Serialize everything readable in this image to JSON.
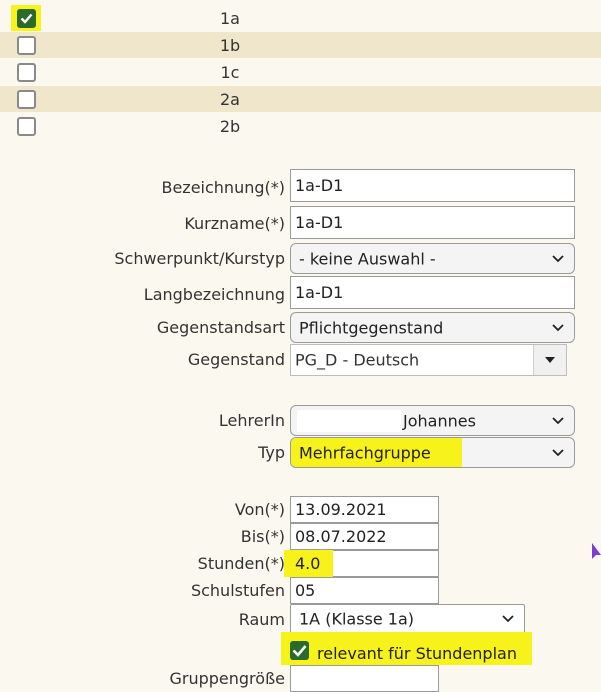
{
  "classes": [
    {
      "label": "1a",
      "checked": true
    },
    {
      "label": "1b",
      "checked": false
    },
    {
      "label": "1c",
      "checked": false
    },
    {
      "label": "2a",
      "checked": false
    },
    {
      "label": "2b",
      "checked": false
    }
  ],
  "form": {
    "bezeichnung": {
      "label": "Bezeichnung(*)",
      "value": "1a-D1"
    },
    "kurzname": {
      "label": "Kurzname(*)",
      "value": "1a-D1"
    },
    "schwerpunkt": {
      "label": "Schwerpunkt/Kurstyp",
      "value": "- keine Auswahl -"
    },
    "langbezeichnung": {
      "label": "Langbezeichnung",
      "value": "1a-D1"
    },
    "gegenstandsart": {
      "label": "Gegenstandsart",
      "value": "Pflichtgegenstand"
    },
    "gegenstand": {
      "label": "Gegenstand",
      "value": "PG_D - Deutsch"
    },
    "lehrerin": {
      "label": "LehrerIn",
      "value": "Johannes"
    },
    "typ": {
      "label": "Typ",
      "value": "Mehrfachgruppe"
    },
    "von": {
      "label": "Von(*)",
      "value": "13.09.2021"
    },
    "bis": {
      "label": "Bis(*)",
      "value": "08.07.2022"
    },
    "stunden": {
      "label": "Stunden(*)",
      "value": "4.0"
    },
    "schulstufen": {
      "label": "Schulstufen",
      "value": "05"
    },
    "raum": {
      "label": "Raum",
      "value": "1A (Klasse 1a)"
    },
    "relevant": {
      "label": "relevant für Stundenplan",
      "checked": true
    },
    "gruppengroesse": {
      "label": "Gruppengröße",
      "value": ""
    }
  },
  "colors": {
    "highlight": "#f7f21a",
    "checkbox_checked": "#2a6b2a",
    "row_alt": "#efe6cc"
  }
}
